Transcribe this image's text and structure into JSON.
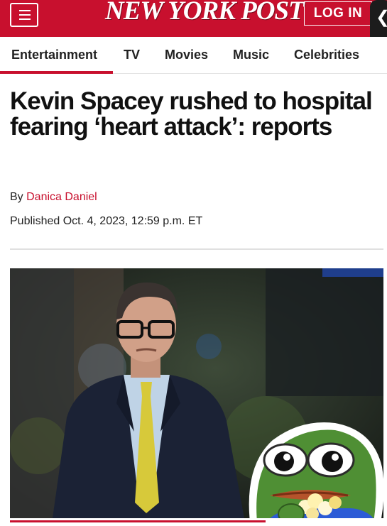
{
  "header": {
    "logo_text": "NEW YORK POST",
    "login_label": "LOG IN",
    "brand_color": "#c8102e"
  },
  "nav": {
    "items": [
      "Entertainment",
      "TV",
      "Movies",
      "Music",
      "Celebrities"
    ],
    "active": "Entertainment"
  },
  "article": {
    "headline": "Kevin Spacey rushed to hospital fearing ‘heart attack’: reports",
    "byline_prefix": "By",
    "author": "Danica Daniel",
    "published": "Published Oct. 4, 2023, 12:59 p.m. ET"
  },
  "icons": {
    "menu": "hamburger-menu-icon",
    "side_tab": "chevron-left-icon",
    "sticker": "pepe-frog-popcorn-sticker"
  }
}
